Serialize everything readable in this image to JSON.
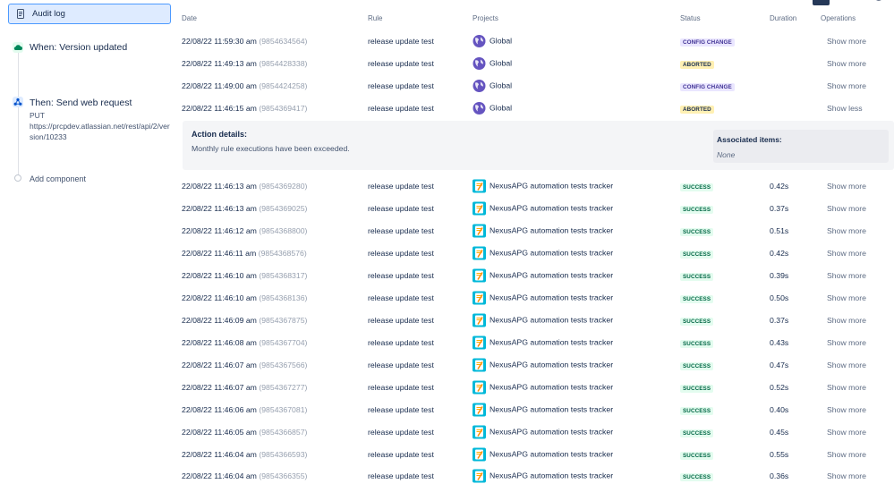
{
  "sidebar": {
    "audit_log_label": "Audit log",
    "trigger": {
      "title": "When: Version updated"
    },
    "action": {
      "title": "Then: Send web request",
      "method": "PUT",
      "url": "https://prcpdev.atlassian.net/rest/api/2/version/10233"
    },
    "add_component": "Add component"
  },
  "table": {
    "headers": {
      "date": "Date",
      "rule": "Rule",
      "projects": "Projects",
      "status": "Status",
      "duration": "Duration",
      "operations": "Operations"
    },
    "rows": [
      {
        "date": "22/08/22 11:59:30 am",
        "id": "(9854634564)",
        "rule": "release update test",
        "project": "Global",
        "project_icon": "globe-icon",
        "status": "CONFIG CHANGE",
        "status_kind": "config",
        "duration": "",
        "op": "Show more"
      },
      {
        "date": "22/08/22 11:49:13 am",
        "id": "(9854428338)",
        "rule": "release update test",
        "project": "Global",
        "project_icon": "globe-icon",
        "status": "ABORTED",
        "status_kind": "aborted",
        "duration": "",
        "op": "Show more"
      },
      {
        "date": "22/08/22 11:49:00 am",
        "id": "(9854424258)",
        "rule": "release update test",
        "project": "Global",
        "project_icon": "globe-icon",
        "status": "CONFIG CHANGE",
        "status_kind": "config",
        "duration": "",
        "op": "Show more"
      },
      {
        "date": "22/08/22 11:46:15 am",
        "id": "(9854369417)",
        "rule": "release update test",
        "project": "Global",
        "project_icon": "globe-icon",
        "status": "ABORTED",
        "status_kind": "aborted",
        "duration": "",
        "op": "Show less"
      },
      {
        "date": "22/08/22 11:46:13 am",
        "id": "(9854369280)",
        "rule": "release update test",
        "project": "NexusAPG automation tests tracker",
        "project_icon": "project-icon",
        "status": "SUCCESS",
        "status_kind": "success",
        "duration": "0.42s",
        "op": "Show more"
      },
      {
        "date": "22/08/22 11:46:13 am",
        "id": "(9854369025)",
        "rule": "release update test",
        "project": "NexusAPG automation tests tracker",
        "project_icon": "project-icon",
        "status": "SUCCESS",
        "status_kind": "success",
        "duration": "0.37s",
        "op": "Show more"
      },
      {
        "date": "22/08/22 11:46:12 am",
        "id": "(9854368800)",
        "rule": "release update test",
        "project": "NexusAPG automation tests tracker",
        "project_icon": "project-icon",
        "status": "SUCCESS",
        "status_kind": "success",
        "duration": "0.51s",
        "op": "Show more"
      },
      {
        "date": "22/08/22 11:46:11 am",
        "id": "(9854368576)",
        "rule": "release update test",
        "project": "NexusAPG automation tests tracker",
        "project_icon": "project-icon",
        "status": "SUCCESS",
        "status_kind": "success",
        "duration": "0.42s",
        "op": "Show more"
      },
      {
        "date": "22/08/22 11:46:10 am",
        "id": "(9854368317)",
        "rule": "release update test",
        "project": "NexusAPG automation tests tracker",
        "project_icon": "project-icon",
        "status": "SUCCESS",
        "status_kind": "success",
        "duration": "0.39s",
        "op": "Show more"
      },
      {
        "date": "22/08/22 11:46:10 am",
        "id": "(9854368136)",
        "rule": "release update test",
        "project": "NexusAPG automation tests tracker",
        "project_icon": "project-icon",
        "status": "SUCCESS",
        "status_kind": "success",
        "duration": "0.50s",
        "op": "Show more"
      },
      {
        "date": "22/08/22 11:46:09 am",
        "id": "(9854367875)",
        "rule": "release update test",
        "project": "NexusAPG automation tests tracker",
        "project_icon": "project-icon",
        "status": "SUCCESS",
        "status_kind": "success",
        "duration": "0.37s",
        "op": "Show more"
      },
      {
        "date": "22/08/22 11:46:08 am",
        "id": "(9854367704)",
        "rule": "release update test",
        "project": "NexusAPG automation tests tracker",
        "project_icon": "project-icon",
        "status": "SUCCESS",
        "status_kind": "success",
        "duration": "0.43s",
        "op": "Show more"
      },
      {
        "date": "22/08/22 11:46:07 am",
        "id": "(9854367566)",
        "rule": "release update test",
        "project": "NexusAPG automation tests tracker",
        "project_icon": "project-icon",
        "status": "SUCCESS",
        "status_kind": "success",
        "duration": "0.47s",
        "op": "Show more"
      },
      {
        "date": "22/08/22 11:46:07 am",
        "id": "(9854367277)",
        "rule": "release update test",
        "project": "NexusAPG automation tests tracker",
        "project_icon": "project-icon",
        "status": "SUCCESS",
        "status_kind": "success",
        "duration": "0.52s",
        "op": "Show more"
      },
      {
        "date": "22/08/22 11:46:06 am",
        "id": "(9854367081)",
        "rule": "release update test",
        "project": "NexusAPG automation tests tracker",
        "project_icon": "project-icon",
        "status": "SUCCESS",
        "status_kind": "success",
        "duration": "0.40s",
        "op": "Show more"
      },
      {
        "date": "22/08/22 11:46:05 am",
        "id": "(9854366857)",
        "rule": "release update test",
        "project": "NexusAPG automation tests tracker",
        "project_icon": "project-icon",
        "status": "SUCCESS",
        "status_kind": "success",
        "duration": "0.45s",
        "op": "Show more"
      },
      {
        "date": "22/08/22 11:46:04 am",
        "id": "(9854366593)",
        "rule": "release update test",
        "project": "NexusAPG automation tests tracker",
        "project_icon": "project-icon",
        "status": "SUCCESS",
        "status_kind": "success",
        "duration": "0.55s",
        "op": "Show more"
      },
      {
        "date": "22/08/22 11:46:04 am",
        "id": "(9854366355)",
        "rule": "release update test",
        "project": "NexusAPG automation tests tracker",
        "project_icon": "project-icon",
        "status": "SUCCESS",
        "status_kind": "success",
        "duration": "0.36s",
        "op": "Show more"
      }
    ],
    "details": {
      "action_title": "Action details:",
      "action_text": "Monthly rule executions have been exceeded.",
      "assoc_title": "Associated items:",
      "assoc_value": "None"
    }
  },
  "colors": {
    "accent": "#0052cc",
    "config": "#403294",
    "aborted_bg": "#fff0b3",
    "success": "#006644"
  }
}
